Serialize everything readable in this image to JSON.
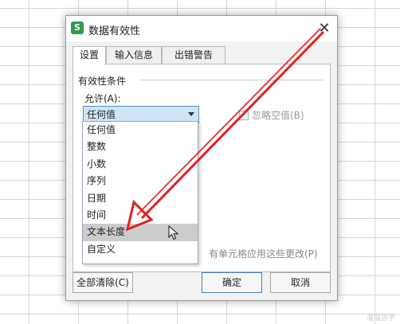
{
  "dialog": {
    "title": "数据有效性",
    "logo_letter": "S",
    "close_label": "✕",
    "tabs": [
      {
        "label": "设置",
        "active": true
      },
      {
        "label": "输入信息",
        "active": false
      },
      {
        "label": "出错警告",
        "active": false
      }
    ],
    "group_label": "有效性条件",
    "allow_label": "允许(A):",
    "allow_value": "任何值",
    "ignore_blank_label": "忽略空值(B)",
    "apply_all_label": "有单元格应用这些更改(P)",
    "dropdown_options": [
      "任何值",
      "整数",
      "小数",
      "序列",
      "日期",
      "时间",
      "文本长度",
      "自定义"
    ],
    "hovered_option": "文本长度",
    "buttons": {
      "clear": "全部清除(C)",
      "ok": "确定",
      "cancel": "取消"
    }
  },
  "colors": {
    "annotation_arrow": "#e02020",
    "logo": "#2e9b4e",
    "combo_selected": "#cde5f7",
    "hover": "#cccccc"
  },
  "watermark": "溜溜自学"
}
